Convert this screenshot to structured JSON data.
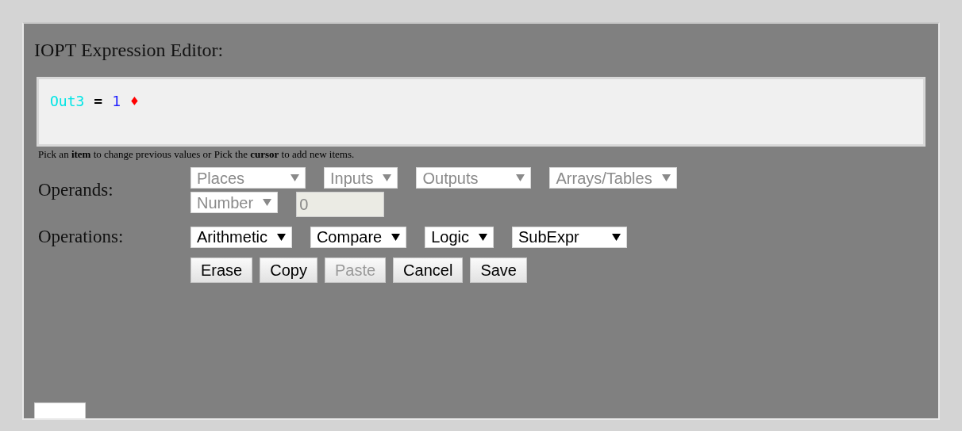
{
  "title": "IOPT Expression Editor:",
  "expression": [
    {
      "kind": "variable",
      "text": "Out3"
    },
    {
      "kind": "operator",
      "text": "="
    },
    {
      "kind": "number",
      "text": "1"
    },
    {
      "kind": "cursor",
      "text": "♦"
    }
  ],
  "hint": "Pick an **item** to change previous values or Pick the **cursor** to add new items.",
  "operands": {
    "label": "Operands:",
    "rows": [
      [
        {
          "label": "Places",
          "disabled": true
        },
        {
          "label": "Inputs",
          "disabled": true
        },
        {
          "label": "Outputs",
          "disabled": true
        },
        {
          "label": "Arrays/Tables",
          "disabled": true
        }
      ],
      [
        {
          "label": "Number",
          "disabled": true
        }
      ]
    ],
    "number_field": {
      "value": "0",
      "disabled": true
    }
  },
  "operations": {
    "label": "Operations:",
    "selects": [
      {
        "label": "Arithmetic",
        "disabled": false
      },
      {
        "label": "Compare",
        "disabled": false
      },
      {
        "label": "Logic",
        "disabled": false
      },
      {
        "label": "SubExpr",
        "disabled": false
      }
    ]
  },
  "buttons": [
    {
      "label": "Erase",
      "disabled": false
    },
    {
      "label": "Copy",
      "disabled": false
    },
    {
      "label": "Paste",
      "disabled": true
    },
    {
      "label": "Cancel",
      "disabled": false
    },
    {
      "label": "Save",
      "disabled": false
    }
  ]
}
